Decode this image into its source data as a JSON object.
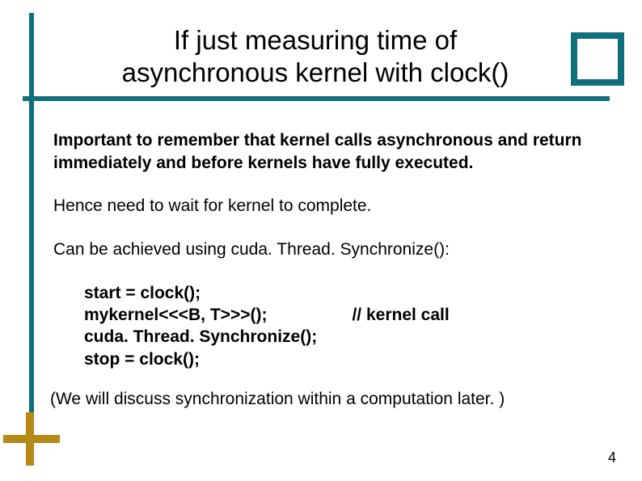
{
  "title": {
    "line1": "If just measuring time of",
    "line2": "asynchronous kernel with clock()"
  },
  "body": {
    "important": "Important to remember that kernel calls asynchronous and return immediately and before kernels have fully executed.",
    "hence": "Hence need to wait for kernel to complete.",
    "achieved": "Can be achieved using cuda. Thread. Synchronize():",
    "code": {
      "l1": "start = clock();",
      "l2": "mykernel<<<B, T>>>();                  // kernel call",
      "l3": "cuda. Thread. Synchronize();",
      "l4": "stop = clock();"
    },
    "closing": "(We will discuss synchronization within a computation later. )"
  },
  "pageNumber": "4",
  "colors": {
    "teal": "#0f6f7a",
    "mustard": "#b38a17"
  }
}
